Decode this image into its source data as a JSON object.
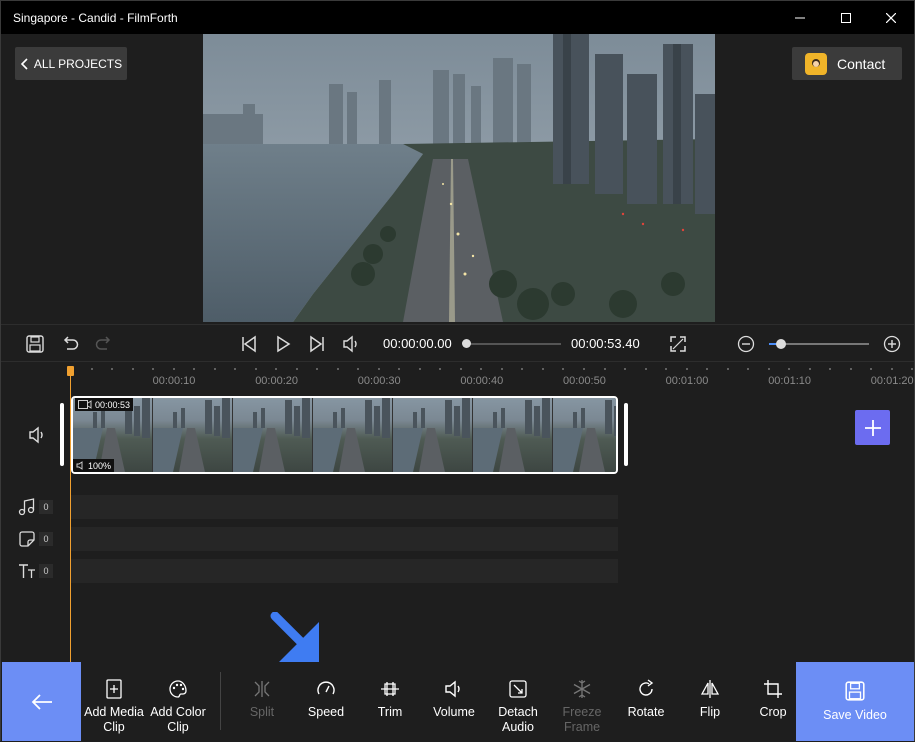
{
  "window": {
    "title": "Singapore - Candid - FilmForth",
    "controls": [
      "minimize-icon",
      "maximize-icon",
      "close-icon"
    ]
  },
  "header": {
    "all_projects_label": "ALL PROJECTS",
    "contact_label": "Contact"
  },
  "playback": {
    "current_time": "00:00:00.00",
    "total_time": "00:00:53.40",
    "progress": 0,
    "zoom_level": 0.12
  },
  "timeline": {
    "ruler_labels": [
      "00:00:10",
      "00:00:20",
      "00:00:30",
      "00:00:40",
      "00:00:50",
      "00:01:00",
      "00:01:10",
      "00:01:20"
    ],
    "clip": {
      "duration": "00:00:53",
      "volume": "100%"
    },
    "tracks": [
      {
        "icon": "music-icon",
        "count": "0"
      },
      {
        "icon": "sticker-icon",
        "count": "0"
      },
      {
        "icon": "text-icon",
        "count": "0"
      }
    ]
  },
  "toolbar": {
    "tools": [
      {
        "id": "add-media-clip",
        "label": "Add Media\nClip",
        "enabled": true
      },
      {
        "id": "add-color-clip",
        "label": "Add Color\nClip",
        "enabled": true
      },
      {
        "id": "split",
        "label": "Split",
        "enabled": false
      },
      {
        "id": "speed",
        "label": "Speed",
        "enabled": true
      },
      {
        "id": "trim",
        "label": "Trim",
        "enabled": true
      },
      {
        "id": "volume",
        "label": "Volume",
        "enabled": true
      },
      {
        "id": "detach-audio",
        "label": "Detach\nAudio",
        "enabled": true
      },
      {
        "id": "freeze-frame",
        "label": "Freeze\nFrame",
        "enabled": false
      },
      {
        "id": "rotate",
        "label": "Rotate",
        "enabled": true
      },
      {
        "id": "flip",
        "label": "Flip",
        "enabled": true
      },
      {
        "id": "crop",
        "label": "Crop",
        "enabled": true
      }
    ],
    "save_label": "Save Video"
  },
  "colors": {
    "accent": "#6c8ef5",
    "add_button": "#6c6cf0",
    "pointer_arrow": "#3f7cf2",
    "playhead": "#f0a030"
  }
}
